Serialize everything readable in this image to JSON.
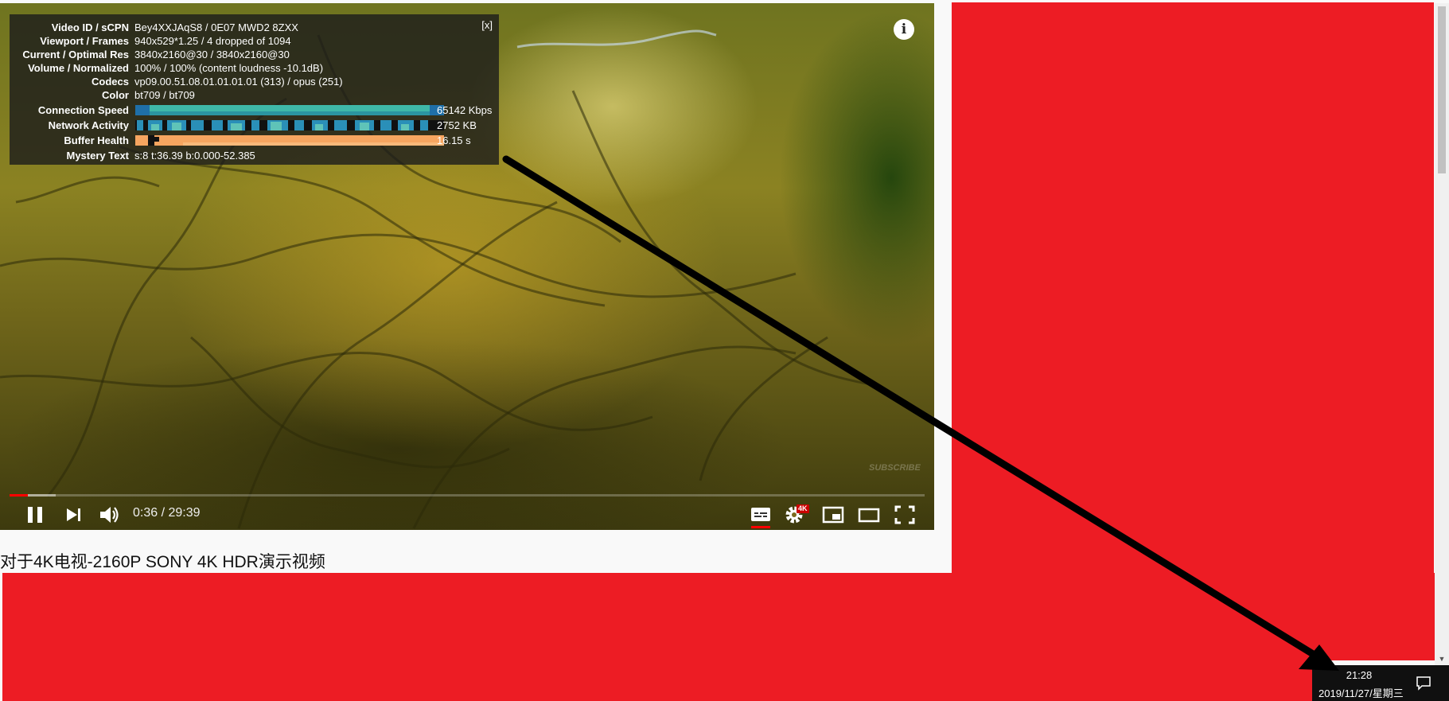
{
  "stats": {
    "close_label": "[x]",
    "rows": [
      {
        "label": "Video ID / sCPN",
        "value": "Bey4XXJAqS8 / 0E07 MWD2 8ZXX"
      },
      {
        "label": "Viewport / Frames",
        "value": "940x529*1.25 / 4 dropped of 1094"
      },
      {
        "label": "Current / Optimal Res",
        "value": "3840x2160@30 / 3840x2160@30"
      },
      {
        "label": "Volume / Normalized",
        "value": "100% / 100% (content loudness -10.1dB)"
      },
      {
        "label": "Codecs",
        "value": "vp09.00.51.08.01.01.01.01 (313) / opus (251)"
      },
      {
        "label": "Color",
        "value": "bt709 / bt709"
      }
    ],
    "connection_speed": {
      "label": "Connection Speed",
      "value": "65142 Kbps"
    },
    "network_activity": {
      "label": "Network Activity",
      "value": "2752 KB"
    },
    "buffer_health": {
      "label": "Buffer Health",
      "value": "16.15 s"
    },
    "mystery_text": {
      "label": "Mystery Text",
      "value": "s:8 t:36.39 b:0.000-52.385"
    }
  },
  "player": {
    "info_symbol": "i",
    "watermark": "SUBSCRIBE",
    "current_time": "0:36",
    "duration": "29:39",
    "time_display": "0:36 / 29:39",
    "progress_fraction": 0.02,
    "loaded_fraction": 0.05,
    "quality_badge": "4K",
    "colors": {
      "progress": "#ff0000",
      "badge": "#cc0000"
    }
  },
  "video_title": "对于4K电视-2160P SONY 4K HDR演示视频",
  "taskbar": {
    "clock_time": "21:28",
    "clock_date": "2019/11/27/星期三"
  },
  "colors": {
    "redaction": "#ed1c24",
    "annotation_arrow": "#000000"
  }
}
